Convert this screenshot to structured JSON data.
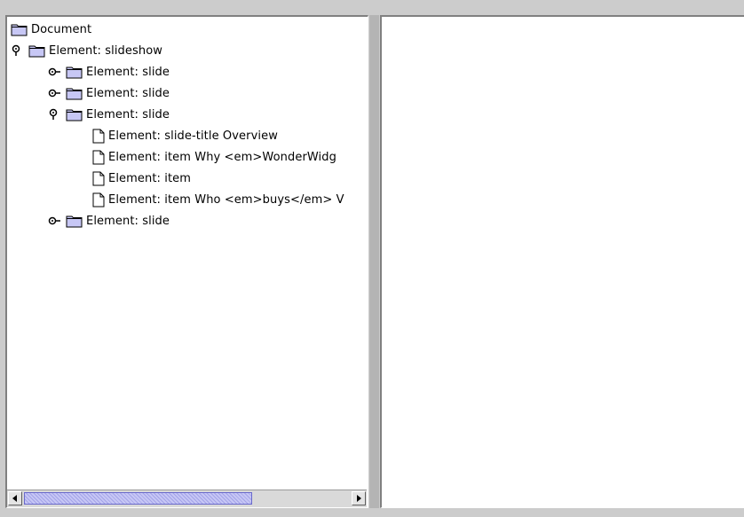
{
  "tree": {
    "nodes": [
      {
        "label": "Document",
        "icon": "folder-icon",
        "toggle": "none"
      },
      {
        "label": "Element: slideshow",
        "icon": "folder-icon",
        "toggle": "expanded"
      },
      {
        "label": "Element: slide",
        "icon": "folder-icon",
        "toggle": "collapsed"
      },
      {
        "label": "Element: slide",
        "icon": "folder-icon",
        "toggle": "collapsed"
      },
      {
        "label": "Element: slide",
        "icon": "folder-icon",
        "toggle": "expanded"
      },
      {
        "label": "Element: slide-title Overview",
        "icon": "document-icon",
        "toggle": "none"
      },
      {
        "label": "Element: item Why <em>WonderWidg",
        "icon": "document-icon",
        "toggle": "none"
      },
      {
        "label": "Element: item",
        "icon": "document-icon",
        "toggle": "none"
      },
      {
        "label": "Element: item Who <em>buys</em> V",
        "icon": "document-icon",
        "toggle": "none"
      },
      {
        "label": "Element: slide",
        "icon": "folder-icon",
        "toggle": "collapsed"
      }
    ]
  },
  "scrollbar": {
    "thumb_start_fraction": 0.0,
    "visible_fraction": 0.7
  },
  "colors": {
    "folder_fill": "#c7c7f5",
    "scroll_thumb": "#c7c7f5",
    "pane_bg": "#ffffff",
    "frame_bg": "#cccccc"
  }
}
